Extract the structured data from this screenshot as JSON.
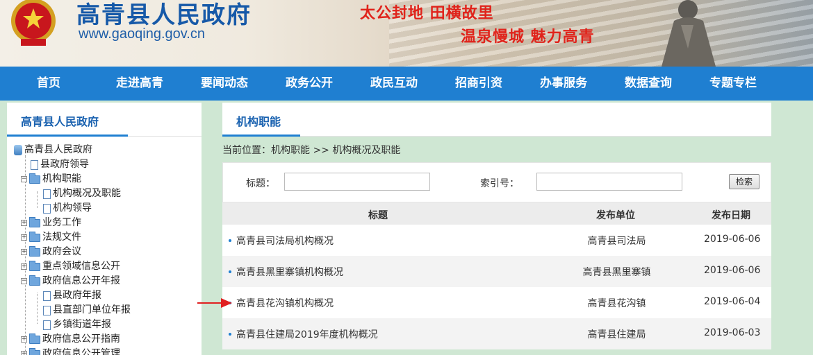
{
  "header": {
    "site_title": "高青县人民政府",
    "site_url": "www.gaoqing.gov.cn",
    "slogan_line1": "太公封地 田横故里",
    "slogan_line2": "温泉慢城 魅力高青"
  },
  "nav": {
    "items": [
      "首页",
      "走进高青",
      "要闻动态",
      "政务公开",
      "政民互动",
      "招商引资",
      "办事服务",
      "数据查询",
      "专题专栏"
    ]
  },
  "sidebar": {
    "title": "高青县人民政府",
    "tree": [
      {
        "label": "高青县人民政府",
        "type": "root"
      },
      {
        "label": "县政府领导",
        "type": "doc"
      },
      {
        "label": "机构职能",
        "type": "folder",
        "expanded": true
      },
      {
        "label": "机构概况及职能",
        "type": "doc"
      },
      {
        "label": "机构领导",
        "type": "doc"
      },
      {
        "label": "业务工作",
        "type": "folder",
        "expanded": false
      },
      {
        "label": "法规文件",
        "type": "folder",
        "expanded": false
      },
      {
        "label": "政府会议",
        "type": "folder",
        "expanded": false
      },
      {
        "label": "重点领域信息公开",
        "type": "folder",
        "expanded": false
      },
      {
        "label": "政府信息公开年报",
        "type": "folder",
        "expanded": true
      },
      {
        "label": "县政府年报",
        "type": "doc"
      },
      {
        "label": "县直部门单位年报",
        "type": "doc"
      },
      {
        "label": "乡镇街道年报",
        "type": "doc"
      },
      {
        "label": "政府信息公开指南",
        "type": "folder",
        "expanded": false
      },
      {
        "label": "政府信息公开管理",
        "type": "folder",
        "expanded": false
      }
    ]
  },
  "main": {
    "title": "机构职能",
    "breadcrumb": "当前位置：机构职能 >> 机构概况及职能",
    "search": {
      "title_label": "标题：",
      "title_value": "",
      "index_label": "索引号：",
      "index_value": "",
      "button_label": "检索"
    },
    "table": {
      "headers": [
        "标题",
        "发布单位",
        "发布日期"
      ],
      "rows": [
        {
          "title": "高青县司法局机构概况",
          "unit": "高青县司法局",
          "date": "2019-06-06"
        },
        {
          "title": "高青县黑里寨镇机构概况",
          "unit": "高青县黑里寨镇",
          "date": "2019-06-06"
        },
        {
          "title": "高青县花沟镇机构概况",
          "unit": "高青县花沟镇",
          "date": "2019-06-04"
        },
        {
          "title": "高青县住建局2019年度机构概况",
          "unit": "高青县住建局",
          "date": "2019-06-03"
        }
      ]
    }
  },
  "colors": {
    "nav_bg": "#1f7fd1",
    "title_blue": "#1a62b0",
    "slogan_red": "#e0231b",
    "page_bg": "#cfe7d3",
    "annotation_arrow": "#e02020"
  }
}
